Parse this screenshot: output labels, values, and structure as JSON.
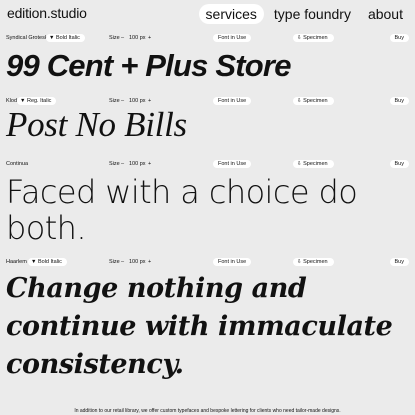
{
  "header": {
    "logo": "edition.studio",
    "nav": [
      "services",
      "type foundry",
      "about"
    ]
  },
  "toolbar_common": {
    "size_label": "Size",
    "minus": "–",
    "size_value": "100 px",
    "plus": "+",
    "font_in_use": "Font in Use",
    "specimen": "⇩ Specimen",
    "buy": "Buy"
  },
  "sections": [
    {
      "font": "Syndical Grotesk",
      "style": "▼ Bold Italic",
      "text": "99 Cent + Plus Store"
    },
    {
      "font": "Klod",
      "style": "▼ Reg. Italic",
      "text": "Post No Bills"
    },
    {
      "font": "Continua",
      "style": "",
      "text": "Faced with a choice do both."
    },
    {
      "font": "Haarlem",
      "style": "▼ Bold Italic",
      "text": "Change nothing and continue with immaculate consistency."
    }
  ],
  "footer": {
    "text": "In addition to our retail library, we offer custom typefaces and bespoke lettering for clients who need tailor-made designs."
  },
  "colors": {
    "background": "#ebebeb",
    "pill": "#ffffff",
    "text": "#111111"
  }
}
